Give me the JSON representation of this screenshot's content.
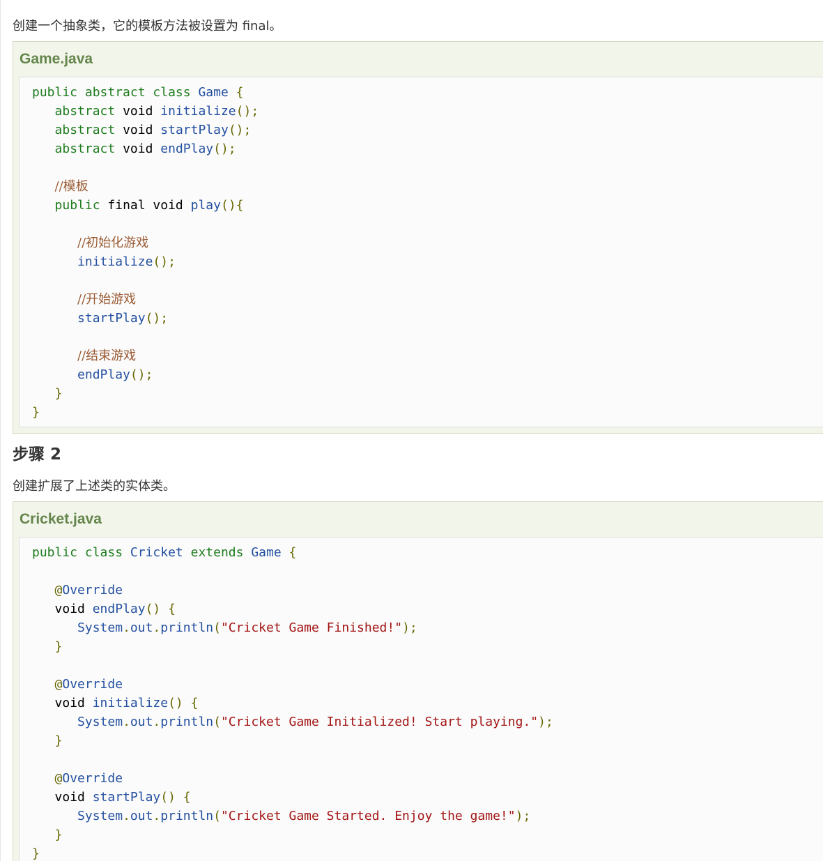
{
  "step1": {
    "intro": "创建一个抽象类，它的模板方法被设置为 final。",
    "filename": "Game.java",
    "lines": [
      [
        [
          "kw",
          "public"
        ],
        [
          "tx",
          " "
        ],
        [
          "kw",
          "abstract"
        ],
        [
          "tx",
          " "
        ],
        [
          "kw",
          "class"
        ],
        [
          "tx",
          " "
        ],
        [
          "nm",
          "Game"
        ],
        [
          "tx",
          " "
        ],
        [
          "pn",
          "{"
        ]
      ],
      [
        [
          "tx",
          "   "
        ],
        [
          "kw",
          "abstract"
        ],
        [
          "tx",
          " "
        ],
        [
          "tx",
          "void"
        ],
        [
          "tx",
          " "
        ],
        [
          "nm",
          "initialize"
        ],
        [
          "pn",
          "();"
        ]
      ],
      [
        [
          "tx",
          "   "
        ],
        [
          "kw",
          "abstract"
        ],
        [
          "tx",
          " "
        ],
        [
          "tx",
          "void"
        ],
        [
          "tx",
          " "
        ],
        [
          "nm",
          "startPlay"
        ],
        [
          "pn",
          "();"
        ]
      ],
      [
        [
          "tx",
          "   "
        ],
        [
          "kw",
          "abstract"
        ],
        [
          "tx",
          " "
        ],
        [
          "tx",
          "void"
        ],
        [
          "tx",
          " "
        ],
        [
          "nm",
          "endPlay"
        ],
        [
          "pn",
          "();"
        ]
      ],
      [],
      [
        [
          "tx",
          "   "
        ],
        [
          "cm",
          "//模板"
        ]
      ],
      [
        [
          "tx",
          "   "
        ],
        [
          "kw",
          "public"
        ],
        [
          "tx",
          " "
        ],
        [
          "tx",
          "final"
        ],
        [
          "tx",
          " "
        ],
        [
          "tx",
          "void"
        ],
        [
          "tx",
          " "
        ],
        [
          "nm",
          "play"
        ],
        [
          "pn",
          "(){"
        ]
      ],
      [],
      [
        [
          "tx",
          "      "
        ],
        [
          "cm",
          "//初始化游戏"
        ]
      ],
      [
        [
          "tx",
          "      "
        ],
        [
          "nm",
          "initialize"
        ],
        [
          "pn",
          "();"
        ]
      ],
      [],
      [
        [
          "tx",
          "      "
        ],
        [
          "cm",
          "//开始游戏"
        ]
      ],
      [
        [
          "tx",
          "      "
        ],
        [
          "nm",
          "startPlay"
        ],
        [
          "pn",
          "();"
        ]
      ],
      [],
      [
        [
          "tx",
          "      "
        ],
        [
          "cm",
          "//结束游戏"
        ]
      ],
      [
        [
          "tx",
          "      "
        ],
        [
          "nm",
          "endPlay"
        ],
        [
          "pn",
          "();"
        ]
      ],
      [
        [
          "tx",
          "   "
        ],
        [
          "pn",
          "}"
        ]
      ],
      [
        [
          "pn",
          "}"
        ]
      ]
    ]
  },
  "step2": {
    "heading": "步骤 2",
    "intro": "创建扩展了上述类的实体类。",
    "filename": "Cricket.java",
    "lines": [
      [
        [
          "kw",
          "public"
        ],
        [
          "tx",
          " "
        ],
        [
          "kw",
          "class"
        ],
        [
          "tx",
          " "
        ],
        [
          "nm",
          "Cricket"
        ],
        [
          "tx",
          " "
        ],
        [
          "kw",
          "extends"
        ],
        [
          "tx",
          " "
        ],
        [
          "nm",
          "Game"
        ],
        [
          "tx",
          " "
        ],
        [
          "pn",
          "{"
        ]
      ],
      [],
      [
        [
          "tx",
          "   "
        ],
        [
          "at",
          "@"
        ],
        [
          "an",
          "Override"
        ]
      ],
      [
        [
          "tx",
          "   "
        ],
        [
          "tx",
          "void"
        ],
        [
          "tx",
          " "
        ],
        [
          "nm",
          "endPlay"
        ],
        [
          "pn",
          "()"
        ],
        [
          "tx",
          " "
        ],
        [
          "pn",
          "{"
        ]
      ],
      [
        [
          "tx",
          "      "
        ],
        [
          "nm",
          "System"
        ],
        [
          "pn",
          "."
        ],
        [
          "nm",
          "out"
        ],
        [
          "pn",
          "."
        ],
        [
          "nm",
          "println"
        ],
        [
          "pn",
          "("
        ],
        [
          "st",
          "\"Cricket Game Finished!\""
        ],
        [
          "pn",
          ");"
        ]
      ],
      [
        [
          "tx",
          "   "
        ],
        [
          "pn",
          "}"
        ]
      ],
      [],
      [
        [
          "tx",
          "   "
        ],
        [
          "at",
          "@"
        ],
        [
          "an",
          "Override"
        ]
      ],
      [
        [
          "tx",
          "   "
        ],
        [
          "tx",
          "void"
        ],
        [
          "tx",
          " "
        ],
        [
          "nm",
          "initialize"
        ],
        [
          "pn",
          "()"
        ],
        [
          "tx",
          " "
        ],
        [
          "pn",
          "{"
        ]
      ],
      [
        [
          "tx",
          "      "
        ],
        [
          "nm",
          "System"
        ],
        [
          "pn",
          "."
        ],
        [
          "nm",
          "out"
        ],
        [
          "pn",
          "."
        ],
        [
          "nm",
          "println"
        ],
        [
          "pn",
          "("
        ],
        [
          "st",
          "\"Cricket Game Initialized! Start playing.\""
        ],
        [
          "pn",
          ");"
        ]
      ],
      [
        [
          "tx",
          "   "
        ],
        [
          "pn",
          "}"
        ]
      ],
      [],
      [
        [
          "tx",
          "   "
        ],
        [
          "at",
          "@"
        ],
        [
          "an",
          "Override"
        ]
      ],
      [
        [
          "tx",
          "   "
        ],
        [
          "tx",
          "void"
        ],
        [
          "tx",
          " "
        ],
        [
          "nm",
          "startPlay"
        ],
        [
          "pn",
          "()"
        ],
        [
          "tx",
          " "
        ],
        [
          "pn",
          "{"
        ]
      ],
      [
        [
          "tx",
          "      "
        ],
        [
          "nm",
          "System"
        ],
        [
          "pn",
          "."
        ],
        [
          "nm",
          "out"
        ],
        [
          "pn",
          "."
        ],
        [
          "nm",
          "println"
        ],
        [
          "pn",
          "("
        ],
        [
          "st",
          "\"Cricket Game Started. Enjoy the game!\""
        ],
        [
          "pn",
          ");"
        ]
      ],
      [
        [
          "tx",
          "   "
        ],
        [
          "pn",
          "}"
        ]
      ],
      [
        [
          "pn",
          "}"
        ]
      ]
    ]
  },
  "colors": {
    "keyword": "#1e7c1e",
    "identifier": "#2450a0",
    "punctuation": "#666600",
    "comment": "#9a5b33",
    "string": "#a31515",
    "example_title": "#64854c",
    "example_background": "#f2f5e9"
  }
}
